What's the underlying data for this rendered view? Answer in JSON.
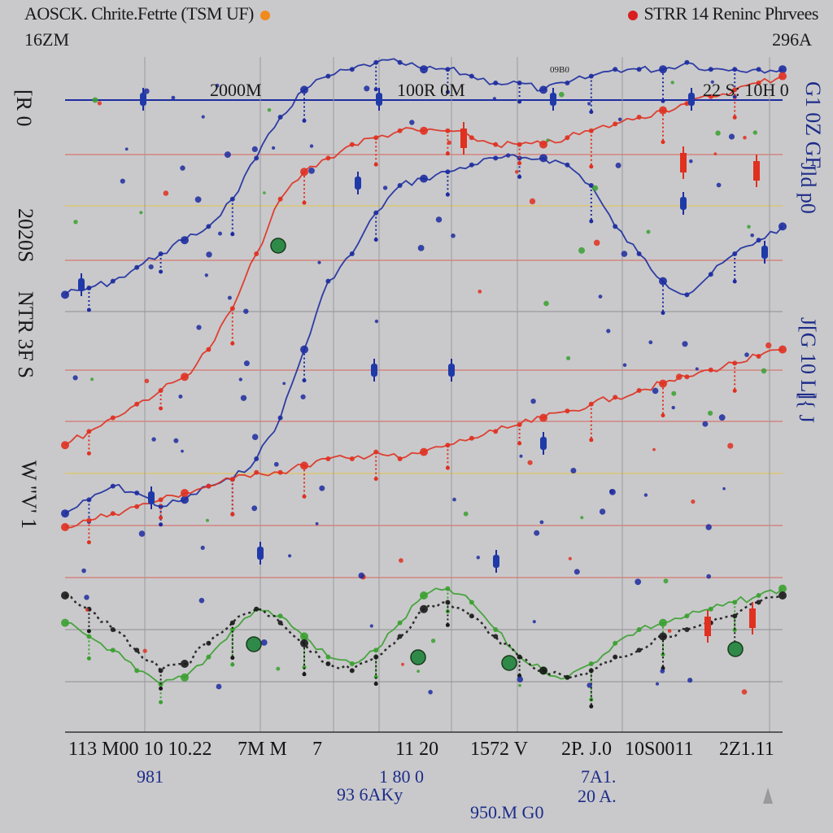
{
  "header": {
    "title_left": "AOSCK. Chrite.Fetrte (TSM UF)",
    "title_right": "STRR 14 Reninc Phrvees",
    "corner_left": "16ZM",
    "corner_right": "296A"
  },
  "top_band": {
    "label_1": "2000M",
    "label_2": "100R 0M",
    "label_3": "22 S: 10H 0",
    "small_tag": "09B0"
  },
  "side_labels": {
    "left_1": "[R 0",
    "left_2": "2020S",
    "left_3": "NTR 3F S",
    "left_4": "W \"V' 1",
    "right_1": "G1 0Z GF",
    "right_2": "Jld p0",
    "right_3": "J[G 10 L]",
    "right_4": "[{ J"
  },
  "x_axis": {
    "ticks": [
      "113 M00 10 10.22",
      "7M M",
      "7",
      "11 20",
      "1572 V",
      "2P. J.0",
      "10S0011",
      "2Z1.11"
    ],
    "sub_1": "981",
    "sub_2": "1 80 0",
    "sub_3": "93 6AKy",
    "sub_4": "7A1.",
    "sub_5": "20 A.",
    "sub_6": "950.M G0"
  },
  "chart_data": {
    "type": "line",
    "title": "AOSCK. Chrite.Fetrte (TSM UF)",
    "legend": "top-right",
    "grid": true,
    "x": [
      0,
      4,
      8,
      12,
      16,
      20,
      24,
      28,
      32,
      36,
      40,
      44,
      48,
      52,
      56,
      60,
      64,
      68,
      72,
      76,
      80,
      84,
      88,
      92,
      96,
      100,
      104,
      108,
      112,
      116,
      120
    ],
    "ylim": [
      0,
      100
    ],
    "series": [
      {
        "color": "#1d2ca0",
        "values": [
          32,
          34,
          36,
          35,
          33,
          34,
          36,
          37,
          40,
          46,
          56,
          66,
          70,
          76,
          80,
          81,
          82,
          83,
          84,
          84,
          84,
          83,
          80,
          74,
          70,
          66,
          64,
          67,
          70,
          72,
          74
        ]
      },
      {
        "color": "#1d2ca0",
        "values": [
          64,
          65,
          66,
          68,
          70,
          72,
          74,
          78,
          84,
          90,
          94,
          96,
          97,
          98,
          98,
          97,
          97,
          96,
          95,
          95,
          94,
          95,
          96,
          97,
          97,
          97,
          98,
          97,
          97,
          97,
          97
        ]
      },
      {
        "color": "#e03020",
        "values": [
          42,
          44,
          46,
          48,
          50,
          52,
          56,
          62,
          70,
          78,
          82,
          84,
          86,
          87,
          88,
          88,
          88,
          87,
          86,
          86,
          86,
          87,
          88,
          89,
          90,
          91,
          92,
          93,
          94,
          95,
          96
        ]
      },
      {
        "color": "#e03020",
        "values": [
          30,
          31,
          32,
          33,
          34,
          35,
          36,
          37,
          38,
          38,
          39,
          40,
          40,
          41,
          40,
          41,
          42,
          43,
          44,
          45,
          46,
          47,
          48,
          49,
          50,
          51,
          52,
          53,
          54,
          55,
          56
        ]
      },
      {
        "color": "#3aa030",
        "values": [
          16,
          14,
          12,
          9,
          7,
          8,
          11,
          15,
          18,
          17,
          14,
          11,
          10,
          12,
          16,
          20,
          21,
          19,
          15,
          11,
          9,
          8,
          10,
          13,
          15,
          16,
          17,
          18,
          19,
          20,
          21
        ]
      },
      {
        "color": "#1a1a1a",
        "values": [
          20,
          18,
          15,
          12,
          9,
          10,
          13,
          16,
          18,
          16,
          13,
          10,
          9,
          11,
          14,
          18,
          19,
          17,
          14,
          11,
          9,
          8,
          9,
          11,
          12,
          14,
          15,
          16,
          17,
          19,
          20
        ]
      }
    ]
  },
  "colors": {
    "background": "#c9c9cb",
    "blue": "#1d2ca0",
    "red": "#e03020",
    "green": "#3aa030",
    "orange": "#f08a1c",
    "grid_red": "#d9645a",
    "grid_yellow": "#e3c54a",
    "grid_gray": "#8e8e90"
  }
}
